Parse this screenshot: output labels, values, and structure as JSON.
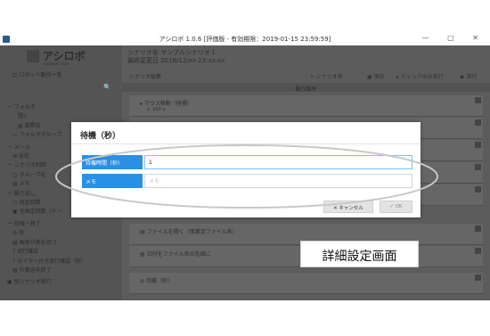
{
  "window": {
    "title": "アシロボ 1.0.6 [評価版 - 有効期限：2019-01-15 23:59:59]",
    "controls": "— ▢ ✕"
  },
  "sidebar": {
    "logo_name": "アシロボ",
    "logo_sub": "assistant robot",
    "robot_list_label": "◫ ロボット動作一覧",
    "search_icon_glyph": "🔍",
    "tree": [
      "ー フォルダ",
      "開く",
      "▤ 園票名",
      "▭ フォルダグループ",
      "ー メール",
      "✉ 送信",
      "ー シナリオ制御",
      "▢ グループ化",
      "▤ メモ",
      "ー 繰り返し",
      "▢ 固定回数",
      "▣ 全固定回数（ドー",
      "ー 待機・終了",
      "⊘ 待",
      "▤ 画像が表を待つ",
      "? 実行確認",
      "? タイマー付き実行確認（秒）",
      "▤ 作業途中終了",
      "▣ 別シナリオ実行"
    ]
  },
  "main": {
    "scenario_line1": "シナリオ名  サンプルシナリオ１",
    "scenario_line2": "最終変更日 2018/12/xx  23:xx:xx",
    "tab_label": "シナリオ編集",
    "toolbar": {
      "new": "＋ シナリオ名",
      "save": "▣ 保存",
      "check": "▸ チェックのみ実行",
      "run": "▶ 実行"
    },
    "column_header": "動作順序",
    "rows": [
      {
        "title": "▸ マウス移動（座標）",
        "sub": "x: 100 y:"
      },
      {
        "title": "",
        "sub": ""
      },
      {
        "title": "",
        "sub": ""
      },
      {
        "title": "",
        "sub": ""
      },
      {
        "title": "",
        "sub": ""
      },
      {
        "title": "▤ ファイルを開く（保護済ファイル名）",
        "sub": ""
      },
      {
        "title": "▤ 日付をファイル名の先頭に",
        "sub": ""
      },
      {
        "title": "⊘ 待機（秒）",
        "sub": ""
      }
    ]
  },
  "dialog": {
    "title": "待機（秒）",
    "fields": [
      {
        "label": "待機時間（秒）",
        "value": "1",
        "placeholder": ""
      },
      {
        "label": "メモ",
        "value": "",
        "placeholder": "メモ"
      }
    ],
    "cancel_label": "✕ キャンセル",
    "ok_label": "✓ OK"
  },
  "caption": "詳細設定画面",
  "colors": {
    "label_blue": "#2b8fe3",
    "overlay": "#5a5a5a",
    "ellipse_stroke": "#c8c8c8"
  }
}
